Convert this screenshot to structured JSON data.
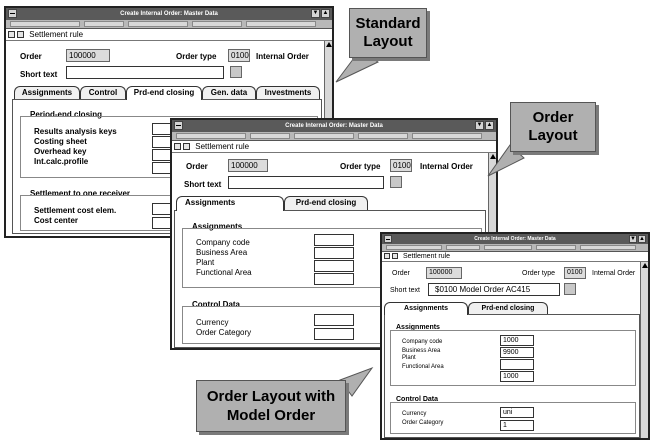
{
  "window_title": "Create Internal Order: Master Data",
  "settlement_rule": "Settlement rule",
  "labels": {
    "order": "Order",
    "order_type": "Order type",
    "short_text": "Short text"
  },
  "order": {
    "number": "100000",
    "type_code": "0100",
    "type_name": "Internal Order"
  },
  "standard_window": {
    "tabs": [
      "Assignments",
      "Control",
      "Prd-end closing",
      "Gen. data",
      "Investments"
    ],
    "period_end": {
      "heading": "Period-end closing",
      "fields": [
        "Results analysis keys",
        "Costing sheet",
        "Overhead key",
        "Int.calc.profile"
      ]
    },
    "settlement": {
      "heading": "Settlement to one receiver",
      "fields": [
        "Settlement cost elem.",
        "Cost center"
      ]
    }
  },
  "order_window": {
    "tabs": [
      "Assignments",
      "Prd-end closing"
    ],
    "assignments": {
      "heading": "Assignments",
      "fields": [
        "Company code",
        "Business Area",
        "Plant",
        "Functional Area"
      ]
    },
    "control": {
      "heading": "Control Data",
      "fields": [
        "Currency",
        "Order Category"
      ]
    }
  },
  "model_window": {
    "short_text_value": "$0100 Model Order AC415",
    "tabs": [
      "Assignments",
      "Prd-end closing"
    ],
    "assignments": {
      "heading": "Assignments",
      "fields": [
        "Company code",
        "Business Area",
        "Plant",
        "Functional Area"
      ],
      "values": [
        "1000",
        "9900",
        "",
        "1000"
      ]
    },
    "control": {
      "heading": "Control Data",
      "fields": [
        "Currency",
        "Order Category"
      ],
      "values": [
        "uni",
        "1"
      ]
    }
  },
  "callouts": {
    "standard": [
      "Standard",
      "Layout"
    ],
    "order": [
      "Order",
      "Layout"
    ],
    "model": [
      "Order Layout with",
      "Model Order"
    ]
  },
  "colors": {
    "callout_fill": "#b0b0b0",
    "titlebar": "#5a5a5a"
  }
}
